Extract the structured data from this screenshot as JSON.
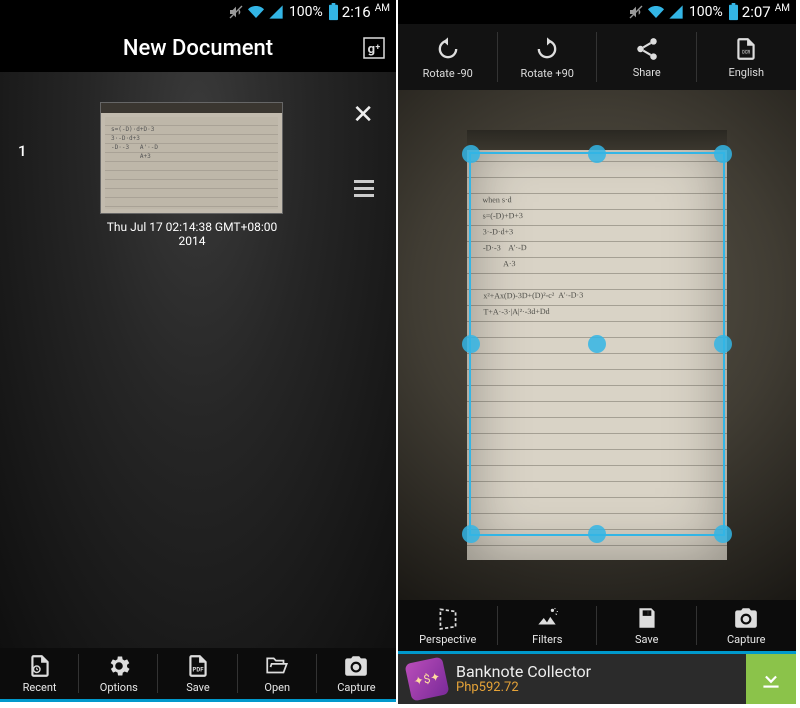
{
  "left": {
    "status": {
      "battery_pct": "100%",
      "time": "2:16",
      "ampm": "AM"
    },
    "title": "New Document",
    "page_number": "1",
    "thumb_caption": "Thu Jul 17 02:14:38 GMT+08:00 2014",
    "toolbar": [
      {
        "label": "Recent"
      },
      {
        "label": "Options"
      },
      {
        "label": "Save"
      },
      {
        "label": "Open"
      },
      {
        "label": "Capture"
      }
    ]
  },
  "right": {
    "status": {
      "battery_pct": "100%",
      "time": "2:07",
      "ampm": "AM"
    },
    "top_toolbar": [
      {
        "label": "Rotate -90"
      },
      {
        "label": "Rotate +90"
      },
      {
        "label": "Share"
      },
      {
        "label": "English"
      }
    ],
    "bottom_toolbar": [
      {
        "label": "Perspective"
      },
      {
        "label": "Filters"
      },
      {
        "label": "Save"
      },
      {
        "label": "Capture"
      }
    ],
    "ad": {
      "title": "Banknote Collector",
      "subtitle": "Php592.72"
    }
  },
  "colors": {
    "accent": "#33b5e5",
    "ad_green": "#8bc34a",
    "ad_orange": "#e6a338"
  }
}
